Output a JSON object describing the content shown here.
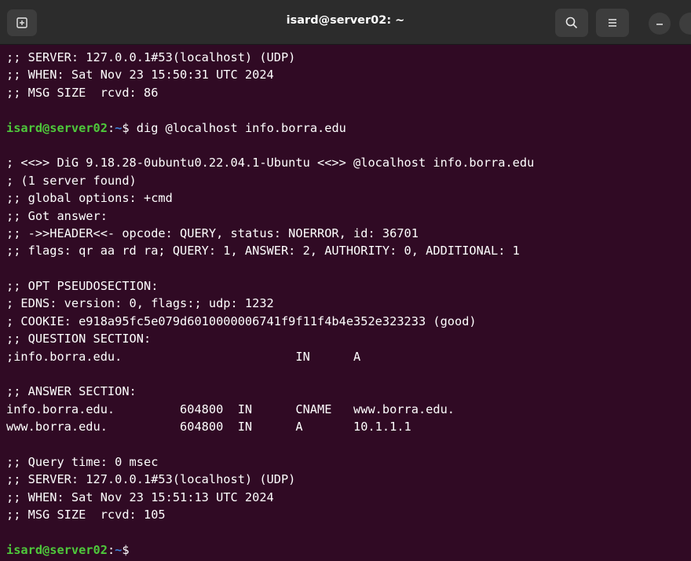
{
  "window": {
    "title": "isard@server02: ~",
    "icons": {
      "new_tab": "new-tab-icon",
      "search": "search-icon",
      "menu": "hamburger-menu-icon",
      "minimize": "minimize-icon",
      "maximize": "maximize-icon"
    }
  },
  "colors": {
    "background": "#300a24",
    "titlebar": "#2c2c2c",
    "prompt_user": "#4ec83b",
    "prompt_path": "#3a80d8",
    "text": "#ffffff"
  },
  "prompt": {
    "user_host": "isard@server02",
    "colon": ":",
    "path": "~",
    "symbol": "$"
  },
  "terminal": {
    "lines": [
      ";; SERVER: 127.0.0.1#53(localhost) (UDP)",
      ";; WHEN: Sat Nov 23 15:50:31 UTC 2024",
      ";; MSG SIZE  rcvd: 86",
      "",
      {
        "command": " dig @localhost info.borra.edu"
      },
      "",
      "; <<>> DiG 9.18.28-0ubuntu0.22.04.1-Ubuntu <<>> @localhost info.borra.edu",
      "; (1 server found)",
      ";; global options: +cmd",
      ";; Got answer:",
      ";; ->>HEADER<<- opcode: QUERY, status: NOERROR, id: 36701",
      ";; flags: qr aa rd ra; QUERY: 1, ANSWER: 2, AUTHORITY: 0, ADDITIONAL: 1",
      "",
      ";; OPT PSEUDOSECTION:",
      "; EDNS: version: 0, flags:; udp: 1232",
      "; COOKIE: e918a95fc5e079d6010000006741f9f11f4b4e352e323233 (good)",
      ";; QUESTION SECTION:",
      ";info.borra.edu.                        IN      A",
      "",
      ";; ANSWER SECTION:",
      "info.borra.edu.         604800  IN      CNAME   www.borra.edu.",
      "www.borra.edu.          604800  IN      A       10.1.1.1",
      "",
      ";; Query time: 0 msec",
      ";; SERVER: 127.0.0.1#53(localhost) (UDP)",
      ";; WHEN: Sat Nov 23 15:51:13 UTC 2024",
      ";; MSG SIZE  rcvd: 105",
      "",
      {
        "command": ""
      }
    ]
  }
}
